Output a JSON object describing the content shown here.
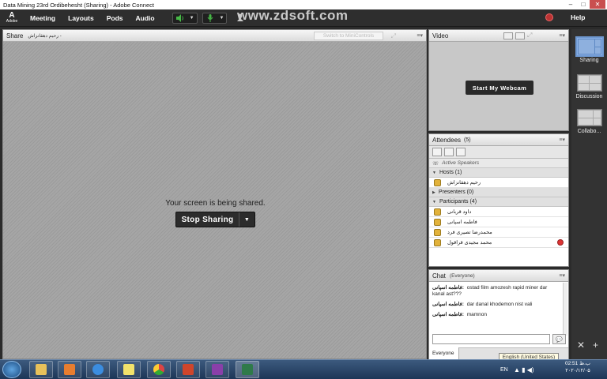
{
  "window": {
    "title": "Data Mining 23rd Ordibehesht (Sharing) - Adobe Connect",
    "controls": [
      "–",
      "□",
      "✕"
    ]
  },
  "menubar": {
    "logo_letter": "A",
    "logo_text": "Adobe",
    "items": [
      "Meeting",
      "Layouts",
      "Pods",
      "Audio"
    ],
    "help": "Help",
    "watermark": "www.zdsoft.com"
  },
  "share_pod": {
    "title": "Share",
    "presenter": "رحیم دهقانزاش -",
    "switch_label": "Switch to MiniControls",
    "message": "Your screen is being shared.",
    "stop_label": "Stop Sharing"
  },
  "video_pod": {
    "title": "Video",
    "webcam_label": "Start My Webcam"
  },
  "attendees_pod": {
    "title": "Attendees",
    "count": "(5)",
    "active_speakers": "Active Speakers",
    "hosts_label": "Hosts (1)",
    "hosts": [
      "رحیم دهقانزاش"
    ],
    "presenters_label": "Presenters (0)",
    "participants_label": "Participants (4)",
    "participants": [
      "داود قربانی",
      "فاطمه اسپانی",
      "محمدرضا تصیری فرد",
      "محمد مجیدی قراقول"
    ]
  },
  "chat_pod": {
    "title": "Chat",
    "scope": "(Everyone)",
    "messages": [
      {
        "sender": "فاطمه اسپانی:",
        "text": "ostad film amozesh rapid miner dar kanal ast???"
      },
      {
        "sender": "فاطمه اسپانی:",
        "text": "dar danal khodemon nist vali"
      },
      {
        "sender": "فاطمه اسپانی:",
        "text": "mamnon"
      }
    ],
    "tab_label": "Everyone"
  },
  "layouts_bar": {
    "items": [
      "Sharing",
      "Discussion",
      "Collabo..."
    ]
  },
  "taskbar": {
    "language_tooltip": "English (United States)",
    "lang": "EN",
    "time": "02:51 ب.ظ",
    "date": "۲۰۲۰/۱۲/۰۵"
  },
  "colors": {
    "mic_green": "#47b847",
    "record_red": "#b33333",
    "layout_active": "#5e89c4"
  }
}
